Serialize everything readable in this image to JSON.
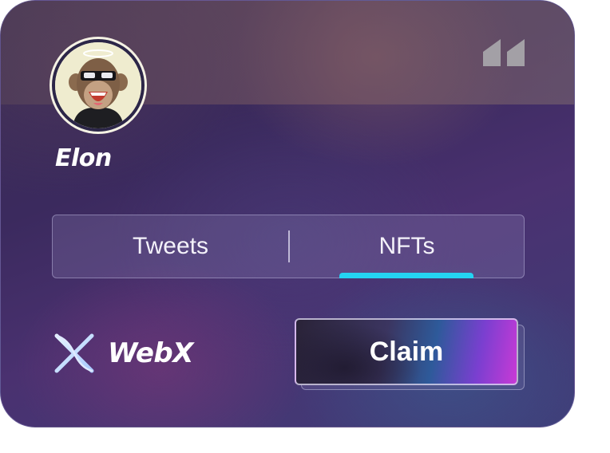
{
  "profile": {
    "name": "Elon"
  },
  "tabs": [
    {
      "label": "Tweets",
      "active": false
    },
    {
      "label": "NFTs",
      "active": true
    }
  ],
  "brand": {
    "name": "WebX",
    "icon": "webx-logo-icon"
  },
  "actions": {
    "claim_label": "Claim"
  },
  "colors": {
    "accent_underline": "#24d3f2",
    "claim_gradient_end": "#c83ad6"
  }
}
